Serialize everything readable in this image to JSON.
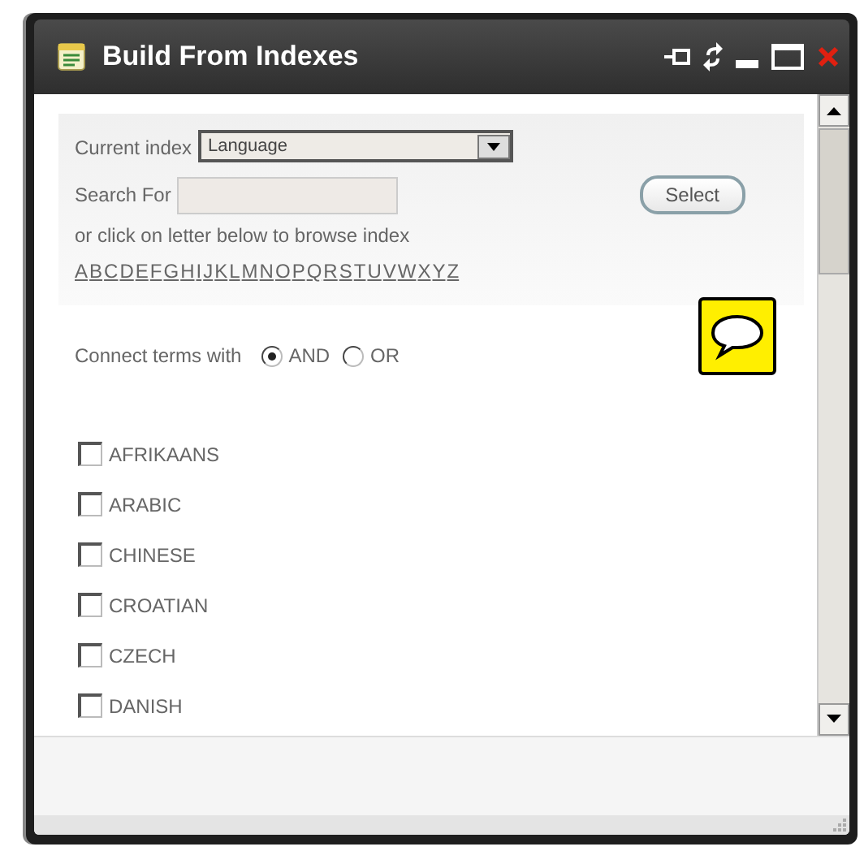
{
  "window": {
    "title": "Build From Indexes"
  },
  "current_index": {
    "label": "Current index",
    "value": "Language"
  },
  "search": {
    "label": "Search For",
    "button": "Select"
  },
  "browse_hint": "or click on letter below to browse index",
  "letters": [
    "A",
    "B",
    "C",
    "D",
    "E",
    "F",
    "G",
    "H",
    "I",
    "J",
    "K",
    "L",
    "M",
    "N",
    "O",
    "P",
    "Q",
    "R",
    "S",
    "T",
    "U",
    "V",
    "W",
    "X",
    "Y",
    "Z"
  ],
  "connect": {
    "label": "Connect terms with",
    "options": [
      {
        "label": "AND",
        "selected": true
      },
      {
        "label": "OR",
        "selected": false
      }
    ]
  },
  "terms": [
    {
      "label": "AFRIKAANS",
      "checked": false
    },
    {
      "label": "ARABIC",
      "checked": false
    },
    {
      "label": "CHINESE",
      "checked": false
    },
    {
      "label": "CROATIAN",
      "checked": false
    },
    {
      "label": "CZECH",
      "checked": false
    },
    {
      "label": "DANISH",
      "checked": false
    }
  ]
}
